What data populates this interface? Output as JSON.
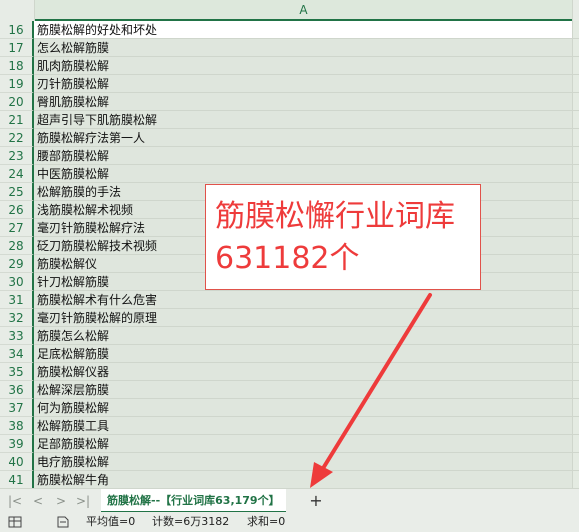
{
  "column_header": "A",
  "rows": [
    {
      "num": "16",
      "text": "筋膜松解的好处和坏处"
    },
    {
      "num": "17",
      "text": "怎么松解筋膜"
    },
    {
      "num": "18",
      "text": "肌肉筋膜松解"
    },
    {
      "num": "19",
      "text": "刃针筋膜松解"
    },
    {
      "num": "20",
      "text": "臀肌筋膜松解"
    },
    {
      "num": "21",
      "text": "超声引导下肌筋膜松解"
    },
    {
      "num": "22",
      "text": "筋膜松解疗法第一人"
    },
    {
      "num": "23",
      "text": "腰部筋膜松解"
    },
    {
      "num": "24",
      "text": "中医筋膜松解"
    },
    {
      "num": "25",
      "text": "松解筋膜的手法"
    },
    {
      "num": "26",
      "text": "浅筋膜松解术视频"
    },
    {
      "num": "27",
      "text": "毫刃针筋膜松解疗法"
    },
    {
      "num": "28",
      "text": "砭刀筋膜松解技术视频"
    },
    {
      "num": "29",
      "text": "筋膜松解仪"
    },
    {
      "num": "30",
      "text": "针刀松解筋膜"
    },
    {
      "num": "31",
      "text": "筋膜松解术有什么危害"
    },
    {
      "num": "32",
      "text": "毫刃针筋膜松解的原理"
    },
    {
      "num": "33",
      "text": "筋膜怎么松解"
    },
    {
      "num": "34",
      "text": "足底松解筋膜"
    },
    {
      "num": "35",
      "text": "筋膜松解仪器"
    },
    {
      "num": "36",
      "text": "松解深层筋膜"
    },
    {
      "num": "37",
      "text": "何为筋膜松解"
    },
    {
      "num": "38",
      "text": "松解筋膜工具"
    },
    {
      "num": "39",
      "text": "足部筋膜松解"
    },
    {
      "num": "40",
      "text": "电疗筋膜松解"
    },
    {
      "num": "41",
      "text": "筋膜松解牛角"
    }
  ],
  "overlay": {
    "line1": "筋膜松懈行业词库",
    "line2": "631182个",
    "color": "#ee3b3b"
  },
  "sheet_nav": {
    "first": "|<",
    "prev": "<",
    "next": ">",
    "last": ">|"
  },
  "sheet_tab": "筋膜松解--【行业词库63,179个】",
  "add_sheet": "+",
  "status": {
    "average": "平均值=0",
    "count": "计数=6万3182",
    "sum": "求和=0"
  },
  "colors": {
    "accent": "#217346",
    "annotation": "#ee3b3b"
  }
}
